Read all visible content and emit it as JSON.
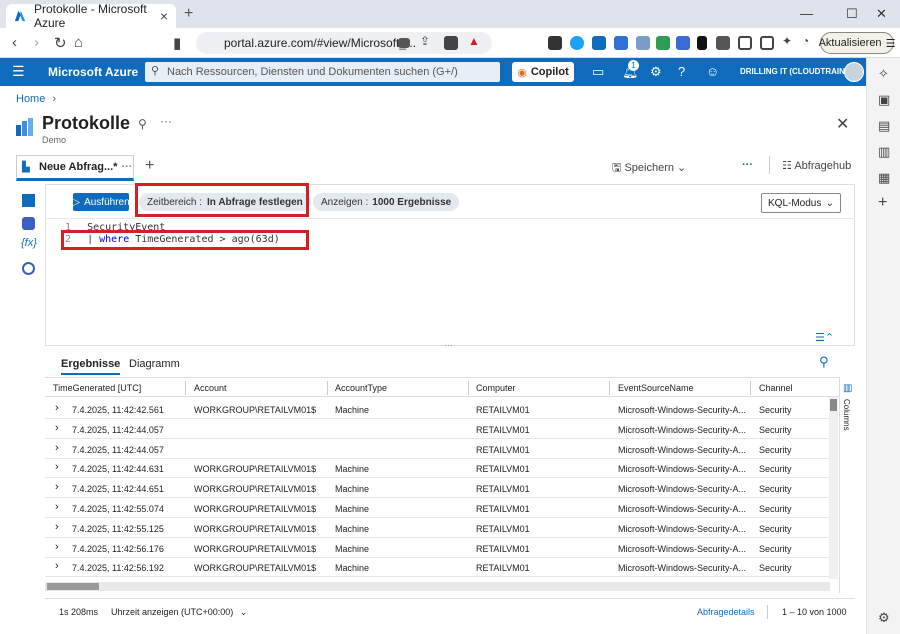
{
  "browser": {
    "tab_title": "Protokolle - Microsoft Azure",
    "url": "portal.azure.com/#view/Microsoft_...",
    "update_label": "Aktualisieren"
  },
  "azure": {
    "brand": "Microsoft Azure",
    "search_placeholder": "Nach Ressourcen, Diensten und Dokumenten suchen (G+/)",
    "copilot_label": "Copilot",
    "notification_count": "1",
    "tenant": "DRILLING IT (CLOUDTRAIN.DE)"
  },
  "page": {
    "breadcrumb": "Home",
    "title": "Protokolle",
    "subtitle": "Demo"
  },
  "query_tab": {
    "label": "Neue Abfrag...*",
    "save_label": "Speichern",
    "hub_label": "Abfragehub"
  },
  "toolbar": {
    "run_label": "Ausführen",
    "time_range_key": "Zeitbereich :",
    "time_range_value": "In Abfrage festlegen",
    "show_key": "Anzeigen :",
    "show_value": "1000 Ergebnisse",
    "mode_label": "KQL-Modus"
  },
  "editor": {
    "lines": [
      {
        "num": "1",
        "text": "SecurityEvent"
      },
      {
        "num": "2",
        "prefix": "| ",
        "keyword": "where",
        "text": " TimeGenerated > ago(63d)"
      }
    ]
  },
  "results": {
    "tabs": [
      "Ergebnisse",
      "Diagramm"
    ],
    "columns": [
      "TimeGenerated [UTC]",
      "Account",
      "AccountType",
      "Computer",
      "EventSourceName",
      "Channel"
    ],
    "rows": [
      [
        "7.4.2025, 11:42:42.561",
        "WORKGROUP\\RETAILVM01$",
        "Machine",
        "RETAILVM01",
        "Microsoft-Windows-Security-A...",
        "Security"
      ],
      [
        "7.4.2025, 11:42:44.057",
        "",
        "",
        "RETAILVM01",
        "Microsoft-Windows-Security-A...",
        "Security"
      ],
      [
        "7.4.2025, 11:42:44.057",
        "",
        "",
        "RETAILVM01",
        "Microsoft-Windows-Security-A...",
        "Security"
      ],
      [
        "7.4.2025, 11:42:44.631",
        "WORKGROUP\\RETAILVM01$",
        "Machine",
        "RETAILVM01",
        "Microsoft-Windows-Security-A...",
        "Security"
      ],
      [
        "7.4.2025, 11:42:44.651",
        "WORKGROUP\\RETAILVM01$",
        "Machine",
        "RETAILVM01",
        "Microsoft-Windows-Security-A...",
        "Security"
      ],
      [
        "7.4.2025, 11:42:55.074",
        "WORKGROUP\\RETAILVM01$",
        "Machine",
        "RETAILVM01",
        "Microsoft-Windows-Security-A...",
        "Security"
      ],
      [
        "7.4.2025, 11:42:55.125",
        "WORKGROUP\\RETAILVM01$",
        "Machine",
        "RETAILVM01",
        "Microsoft-Windows-Security-A...",
        "Security"
      ],
      [
        "7.4.2025, 11:42:56.176",
        "WORKGROUP\\RETAILVM01$",
        "Machine",
        "RETAILVM01",
        "Microsoft-Windows-Security-A...",
        "Security"
      ],
      [
        "7.4.2025, 11:42:56.192",
        "WORKGROUP\\RETAILVM01$",
        "Machine",
        "RETAILVM01",
        "Microsoft-Windows-Security-A...",
        "Security"
      ]
    ],
    "columns_side_label": "Columns"
  },
  "footer": {
    "duration": "1s 208ms",
    "time_display": "Uhrzeit anzeigen (UTC+00:00)",
    "details_label": "Abfragedetails",
    "range": "1 – 10 von 1000"
  },
  "colors": {
    "azure_blue": "#0f6cbd",
    "highlight_red": "#d42025"
  }
}
